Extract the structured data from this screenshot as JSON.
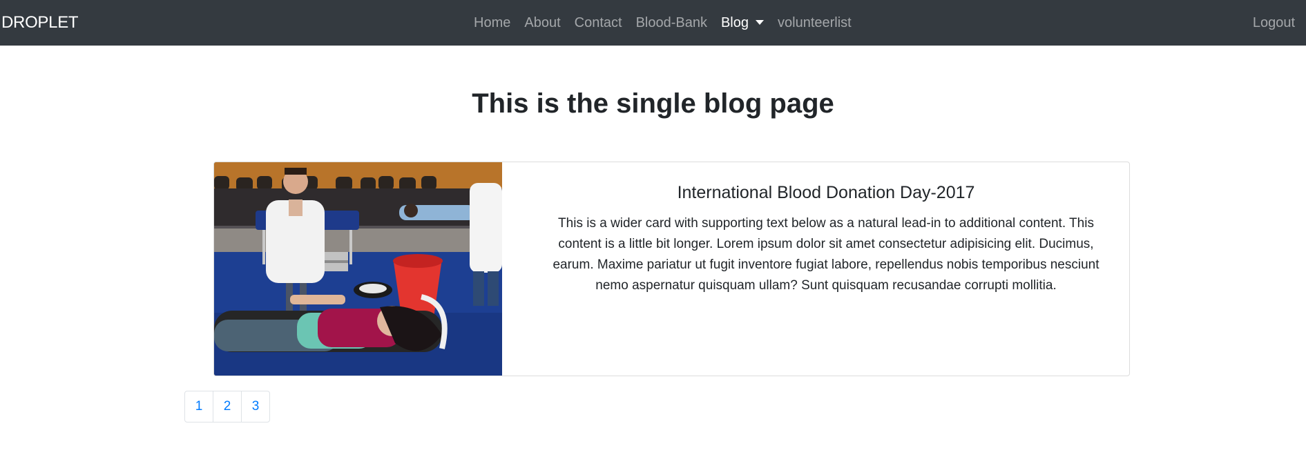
{
  "navbar": {
    "brand": "DROPLET",
    "links": [
      {
        "label": "Home"
      },
      {
        "label": "About"
      },
      {
        "label": "Contact"
      },
      {
        "label": "Blood-Bank"
      },
      {
        "label": "Blog"
      },
      {
        "label": "volunteerlist"
      }
    ],
    "logout": "Logout",
    "background_color": "#343a40"
  },
  "main": {
    "title": "This is the single blog page",
    "card": {
      "title": "International Blood Donation Day-2017",
      "text": "This is a wider card with supporting text below as a natural lead-in to additional content. This content is a little bit longer. Lorem ipsum dolor sit amet consectetur adipisicing elit. Ducimus, earum. Maxime pariatur ut fugit inventore fugiat labore, repellendus nobis temporibus nesciunt nemo aspernatur quisquam ullam? Sunt quisquam recusandae corrupti mollitia."
    }
  },
  "pagination": {
    "pages": [
      "1",
      "2",
      "3"
    ],
    "link_color": "#007bff"
  }
}
